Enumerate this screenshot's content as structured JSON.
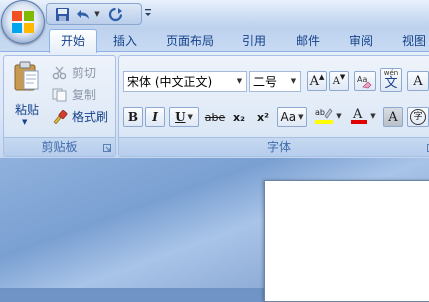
{
  "window": {
    "icons": [
      "office-button",
      "save-icon",
      "undo-icon",
      "redo-icon",
      "customize-qat-icon"
    ]
  },
  "tabs": [
    {
      "label": "开始",
      "active": true
    },
    {
      "label": "插入"
    },
    {
      "label": "页面布局"
    },
    {
      "label": "引用"
    },
    {
      "label": "邮件"
    },
    {
      "label": "审阅"
    },
    {
      "label": "视图"
    }
  ],
  "clipboard": {
    "paste_label": "粘贴",
    "cut_label": "剪切",
    "copy_label": "复制",
    "format_painter_label": "格式刷",
    "group_label": "剪贴板"
  },
  "font": {
    "font_name": "宋体 (中文正文)",
    "font_size": "二号",
    "grow_label": "A",
    "shrink_label": "A",
    "phonetic_label": "wén",
    "phonetic_char": "文",
    "char_border_label": "A",
    "bold": "B",
    "italic": "I",
    "underline": "U",
    "strike": "abe",
    "subscript": "x₂",
    "superscript": "x²",
    "change_case": "Aa",
    "highlight": "ab",
    "font_color": "A",
    "char_shading": "A",
    "enclose": "字",
    "group_label": "字体"
  },
  "colors": {
    "highlight_yellow": "#ffff00",
    "font_red": "#e00000",
    "ribbon_text": "#15428b"
  }
}
